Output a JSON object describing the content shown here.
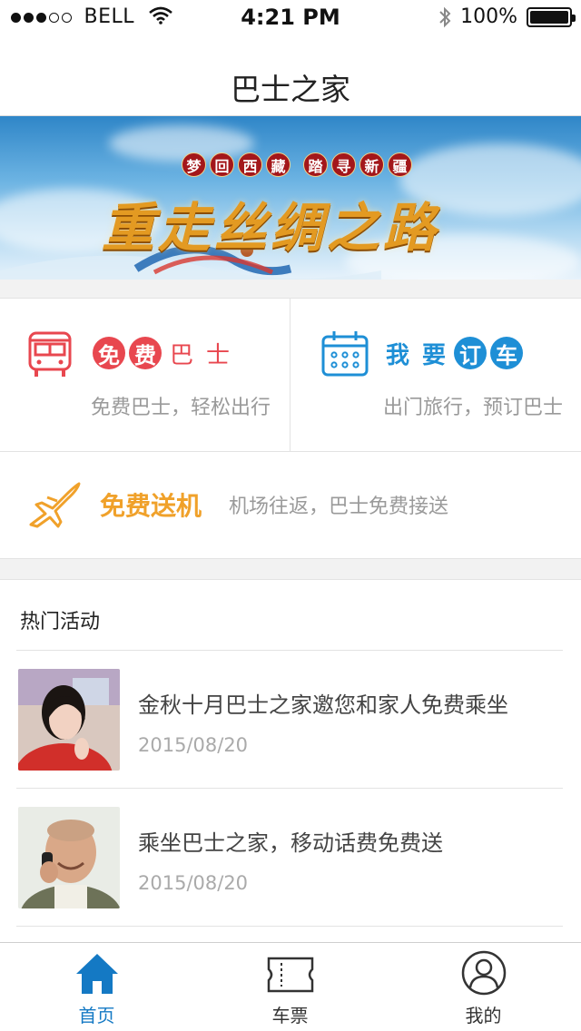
{
  "status_bar": {
    "carrier": "BELL",
    "time": "4:21 PM",
    "battery": "100%"
  },
  "nav": {
    "title": "巴士之家"
  },
  "banner": {
    "tags": [
      "梦",
      "回",
      "西",
      "藏",
      "踏",
      "寻",
      "新",
      "疆"
    ],
    "headline": "重走丝绸之路",
    "slide_count": 3,
    "active_slide": 1,
    "colors": {
      "sky": "#2f86c8",
      "accent": "#1479c4",
      "tag": "#a3171b",
      "gold": "#e39a22"
    }
  },
  "services": {
    "free_bus": {
      "chars": [
        "免",
        "费",
        "巴",
        "士"
      ],
      "subtitle": "免费巴士，轻松出行",
      "color": "#e8474f",
      "icon": "bus-icon"
    },
    "book_bus": {
      "chars": [
        "我",
        "要",
        "订",
        "车"
      ],
      "subtitle": "出门旅行，预订巴士",
      "color": "#1e8fd6",
      "icon": "calendar-icon"
    },
    "airport": {
      "title": "免费送机",
      "subtitle": "机场往返，巴士免费接送",
      "color": "#f0a12a",
      "icon": "airplane-icon"
    }
  },
  "activities": {
    "header": "热门活动",
    "items": [
      {
        "title": "金秋十月巴士之家邀您和家人免费乘坐",
        "date": "2015/08/20"
      },
      {
        "title": "乘坐巴士之家，移动话费免费送",
        "date": "2015/08/20"
      }
    ]
  },
  "tabs": [
    {
      "label": "首页",
      "icon": "home-icon",
      "active": true
    },
    {
      "label": "车票",
      "icon": "ticket-icon",
      "active": false
    },
    {
      "label": "我的",
      "icon": "user-icon",
      "active": false
    }
  ]
}
